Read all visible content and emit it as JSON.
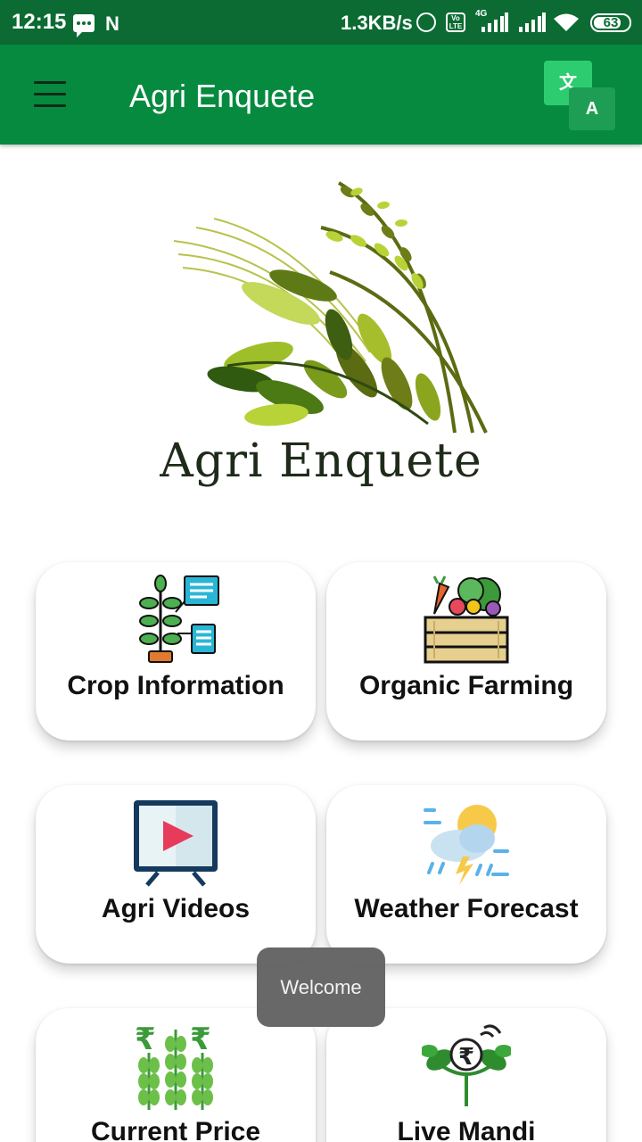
{
  "status_bar": {
    "time": "12:15",
    "network_speed": "1.3KB/s",
    "volte_label": "Vo LTE",
    "network_type": "4G",
    "battery_level": "63"
  },
  "app_bar": {
    "title": "Agri Enquete",
    "translate_source_glyph": "文",
    "translate_target_glyph": "A"
  },
  "logo": {
    "text": "Agri Enquete"
  },
  "cards": [
    {
      "label": "Crop Information",
      "icon": "plant-info-icon"
    },
    {
      "label": "Organic Farming",
      "icon": "vegetable-crate-icon"
    },
    {
      "label": "Agri Videos",
      "icon": "video-player-icon"
    },
    {
      "label": "Weather Forecast",
      "icon": "weather-icon"
    },
    {
      "label": "Current Price",
      "icon": "rupee-wheat-icon"
    },
    {
      "label": "Live Mandi",
      "icon": "rupee-plant-icon"
    }
  ],
  "toast": {
    "message": "Welcome"
  },
  "colors": {
    "status_bar": "#0b6b33",
    "app_bar": "#068a3f",
    "card_background": "#ffffff",
    "toast_background": "#646464"
  }
}
